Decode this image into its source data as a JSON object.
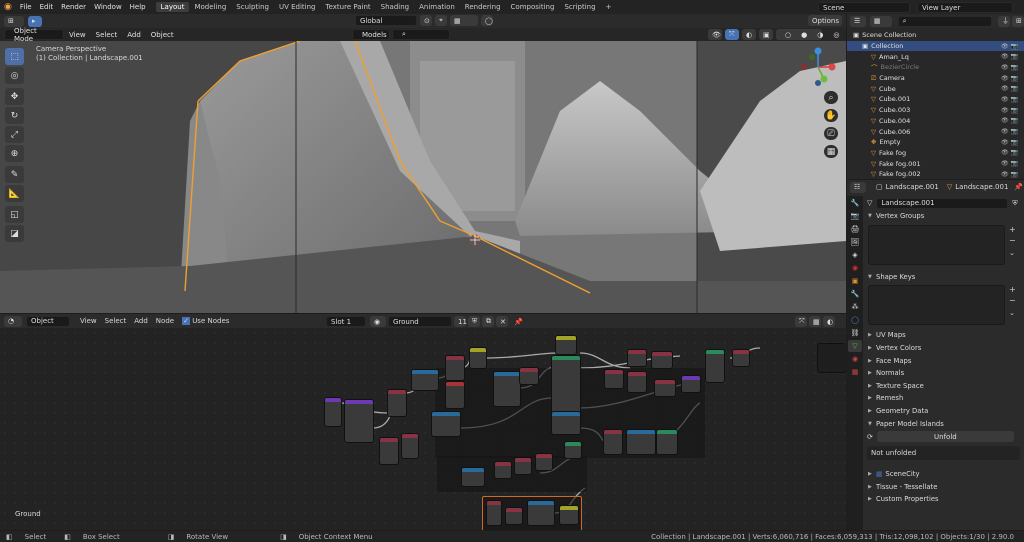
{
  "topbar": {
    "menus": [
      "File",
      "Edit",
      "Render",
      "Window",
      "Help"
    ],
    "workspaces": [
      "Layout",
      "Modeling",
      "Sculpting",
      "UV Editing",
      "Texture Paint",
      "Shading",
      "Animation",
      "Rendering",
      "Compositing",
      "Scripting"
    ],
    "active_workspace": "Layout",
    "scene": "Scene",
    "view_layer": "View Layer"
  },
  "viewport": {
    "mode": "Object Mode",
    "menus": [
      "View",
      "Select",
      "Add",
      "Object"
    ],
    "transform": "Global",
    "options": "Options",
    "collection_filter": "Models",
    "info_line1": "Camera Perspective",
    "info_line2": "(1) Collection | Landscape.001"
  },
  "node_editor": {
    "editor_type": "Object",
    "menus": [
      "View",
      "Select",
      "Add",
      "Node"
    ],
    "use_nodes": "Use Nodes",
    "slot": "Slot 1",
    "material": "Ground",
    "users": "11",
    "material_label": "Ground"
  },
  "status": {
    "items": [
      "Select",
      "Box Select",
      "Rotate View",
      "Object Context Menu"
    ],
    "stats": "Collection | Landscape.001 | Verts:6,060,716 | Faces:6,059,313 | Tris:12,098,102 | Objects:1/30 | 2.90.0"
  },
  "outliner": {
    "items": [
      {
        "label": "Scene Collection",
        "indent": 0,
        "icon": "collection"
      },
      {
        "label": "Collection",
        "indent": 1,
        "icon": "collection"
      },
      {
        "label": "Aman_Lq",
        "indent": 2,
        "icon": "mesh"
      },
      {
        "label": "BezierCircle",
        "indent": 2,
        "icon": "curve",
        "muted": true
      },
      {
        "label": "Camera",
        "indent": 2,
        "icon": "camera"
      },
      {
        "label": "Cube",
        "indent": 2,
        "icon": "mesh"
      },
      {
        "label": "Cube.001",
        "indent": 2,
        "icon": "mesh"
      },
      {
        "label": "Cube.003",
        "indent": 2,
        "icon": "mesh"
      },
      {
        "label": "Cube.004",
        "indent": 2,
        "icon": "mesh"
      },
      {
        "label": "Cube.006",
        "indent": 2,
        "icon": "mesh"
      },
      {
        "label": "Empty",
        "indent": 2,
        "icon": "empty"
      },
      {
        "label": "Fake fog",
        "indent": 2,
        "icon": "mesh"
      },
      {
        "label": "Fake fog.001",
        "indent": 2,
        "icon": "mesh"
      },
      {
        "label": "Fake fog.002",
        "indent": 2,
        "icon": "mesh"
      }
    ]
  },
  "properties": {
    "object": "Landscape.001",
    "data": "Landscape.001",
    "mesh_name": "Landscape.001",
    "vertex_groups": "Vertex Groups",
    "shape_keys": "Shape Keys",
    "sections": [
      "UV Maps",
      "Vertex Colors",
      "Face Maps",
      "Normals",
      "Texture Space",
      "Remesh",
      "Geometry Data",
      "Paper Model Islands"
    ],
    "unfold_label": "Unfold",
    "not_unfolded": "Not unfolded",
    "bottom_sections": [
      "SceneCity",
      "Tissue - Tessellate",
      "Custom Properties"
    ]
  },
  "colors": {
    "accent": "#4772b3",
    "selection_outline": "#f0a030"
  }
}
